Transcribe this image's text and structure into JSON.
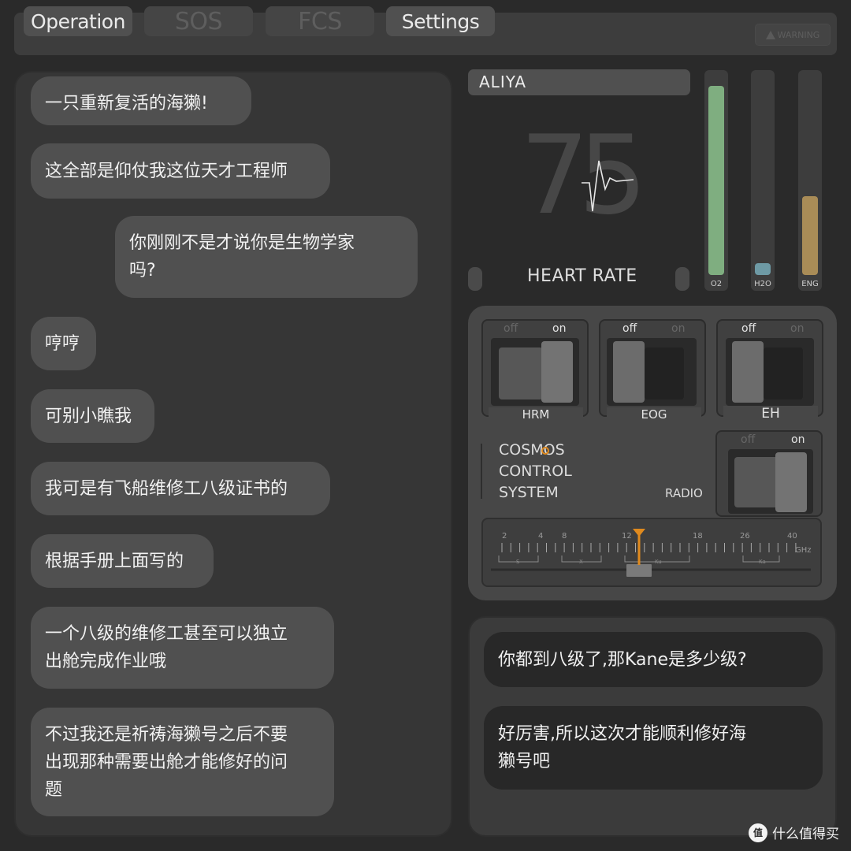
{
  "tabs": [
    {
      "label": "Operation",
      "enabled": true
    },
    {
      "label": "SOS",
      "enabled": false
    },
    {
      "label": "FCS",
      "enabled": false
    },
    {
      "label": "Settings",
      "enabled": true
    }
  ],
  "warning": {
    "label": "WARNING",
    "icon": "warning-triangle-icon"
  },
  "chat_left": [
    "一只重新复活的海獭!",
    "这全部是仰仗我这位天才工程师",
    "你刚刚不是才说你是生物学家\n吗?",
    "哼哼",
    "可别小瞧我",
    "我可是有飞船维修工八级证书的",
    "根据手册上面写的",
    "一个八级的维修工甚至可以独立\n出舱完成作业哦",
    "不过我还是祈祷海獭号之后不要\n出现那种需要出舱才能修好的问\n题"
  ],
  "monitor": {
    "name": "ALIYA",
    "heart_rate_value": "75",
    "heart_rate_label": "HEART RATE"
  },
  "gauges": [
    {
      "label": "O2",
      "level": 0.96,
      "color": "#7fae80"
    },
    {
      "label": "H2O",
      "level": 0.06,
      "color": "#6e9aa5"
    },
    {
      "label": "ENG",
      "level": 0.4,
      "color": "#a98c57"
    }
  ],
  "switches": {
    "off_label": "off",
    "on_label": "on",
    "items": [
      {
        "label": "HRM",
        "state": "on"
      },
      {
        "label": "EOG",
        "state": "off"
      },
      {
        "label": "EH",
        "state": "off"
      },
      {
        "label": "RADIO",
        "state": "on"
      }
    ]
  },
  "cosmos": {
    "line1": "COSMOS",
    "line2": "CONTROL",
    "line3": "SYSTEM"
  },
  "tuner": {
    "ticks": [
      "2",
      "4",
      "8",
      "12",
      "18",
      "26",
      "40"
    ],
    "unit": "GHz",
    "bands": [
      "S",
      "X",
      "Ku",
      "Ka"
    ],
    "accent": "#e08a1e"
  },
  "chat_right": [
    "你都到八级了,那Kane是多少级?",
    "好厉害,所以这次才能顺利修好海\n獭号吧"
  ],
  "watermark": {
    "icon_text": "值",
    "text": "什么值得买"
  }
}
